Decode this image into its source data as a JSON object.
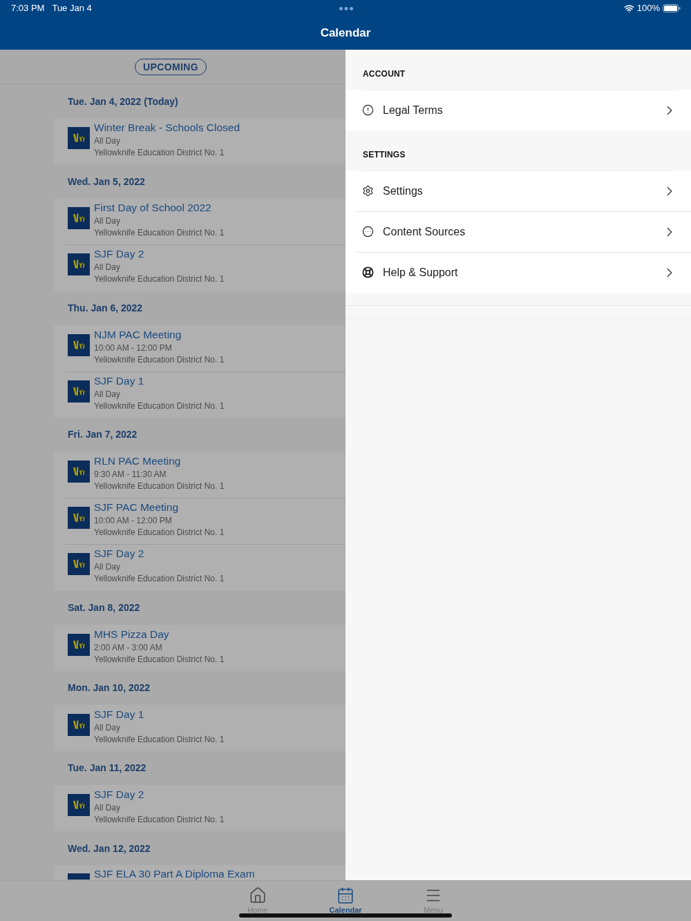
{
  "status_bar": {
    "time": "7:03 PM",
    "date": "Tue Jan 4",
    "battery": "100%"
  },
  "nav_bar": {
    "title": "Calendar"
  },
  "calendar": {
    "filter": "UPCOMING",
    "days": [
      {
        "date": "Tue. Jan 4, 2022 (Today)",
        "events": [
          {
            "title": "Winter Break - Schools Closed",
            "time": "All Day",
            "source": "Yellowknife Education District No. 1"
          }
        ]
      },
      {
        "date": "Wed. Jan 5, 2022",
        "events": [
          {
            "title": "First Day of School 2022",
            "time": "All Day",
            "source": "Yellowknife Education District No. 1"
          },
          {
            "title": "SJF Day 2",
            "time": "All Day",
            "source": "Yellowknife Education District No. 1"
          }
        ]
      },
      {
        "date": "Thu. Jan 6, 2022",
        "events": [
          {
            "title": "NJM PAC Meeting",
            "time": "10:00 AM - 12:00 PM",
            "source": "Yellowknife Education District No. 1"
          },
          {
            "title": "SJF Day 1",
            "time": "All Day",
            "source": "Yellowknife Education District No. 1"
          }
        ]
      },
      {
        "date": "Fri. Jan 7, 2022",
        "events": [
          {
            "title": "RLN PAC Meeting",
            "time": "9:30 AM - 11:30 AM",
            "source": "Yellowknife Education District No. 1"
          },
          {
            "title": "SJF PAC Meeting",
            "time": "10:00 AM - 12:00 PM",
            "source": "Yellowknife Education District No. 1"
          },
          {
            "title": "SJF Day 2",
            "time": "All Day",
            "source": "Yellowknife Education District No. 1"
          }
        ]
      },
      {
        "date": "Sat. Jan 8, 2022",
        "events": [
          {
            "title": "MHS Pizza Day",
            "time": "2:00 AM - 3:00 AM",
            "source": "Yellowknife Education District No. 1"
          }
        ]
      },
      {
        "date": "Mon. Jan 10, 2022",
        "events": [
          {
            "title": "SJF Day 1",
            "time": "All Day",
            "source": "Yellowknife Education District No. 1"
          }
        ]
      },
      {
        "date": "Tue. Jan 11, 2022",
        "events": [
          {
            "title": "SJF Day 2",
            "time": "All Day",
            "source": "Yellowknife Education District No. 1"
          }
        ]
      },
      {
        "date": "Wed. Jan 12, 2022",
        "events": [
          {
            "title": "SJF ELA 30 Part A Diploma Exam"
          }
        ]
      }
    ]
  },
  "menu": {
    "sections": [
      {
        "heading": "ACCOUNT",
        "items": [
          {
            "label": "Legal Terms"
          }
        ]
      },
      {
        "heading": "SETTINGS",
        "items": [
          {
            "label": "Settings"
          },
          {
            "label": "Content Sources"
          },
          {
            "label": "Help & Support"
          }
        ]
      }
    ]
  },
  "tab_bar": {
    "tabs": [
      {
        "label": "Home",
        "selected": false
      },
      {
        "label": "Calendar",
        "selected": true
      },
      {
        "label": "Menu",
        "selected": false
      }
    ]
  }
}
